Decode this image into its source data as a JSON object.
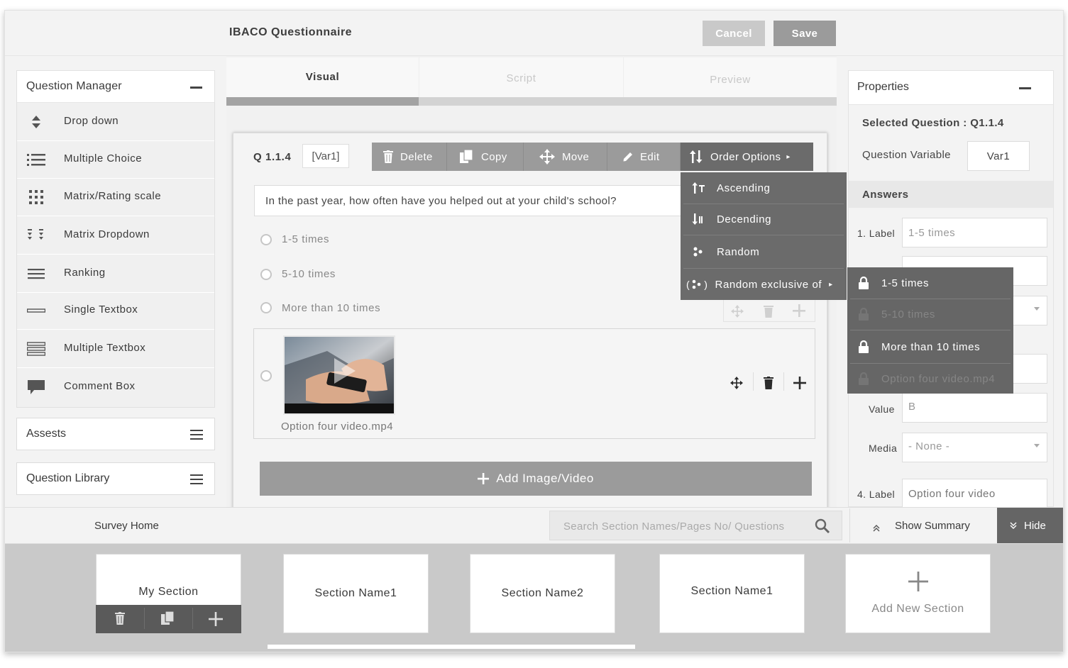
{
  "app": {
    "title": "IBACO Questionnaire",
    "cancel_label": "Cancel",
    "save_label": "Save"
  },
  "question_manager": {
    "title": "Question Manager",
    "items": [
      {
        "label": "Drop down",
        "icon": "updown-icon"
      },
      {
        "label": "Multiple Choice",
        "icon": "list-icon"
      },
      {
        "label": "Matrix/Rating scale",
        "icon": "grid-icon"
      },
      {
        "label": "Matrix Dropdown",
        "icon": "matrix-dropdown-icon"
      },
      {
        "label": "Ranking",
        "icon": "ranking-icon"
      },
      {
        "label": "Single Textbox",
        "icon": "single-textbox-icon"
      },
      {
        "label": "Multiple Textbox",
        "icon": "multiple-textbox-icon"
      },
      {
        "label": "Comment Box",
        "icon": "comment-icon"
      }
    ]
  },
  "assets_panel": {
    "title": "Assests"
  },
  "library_panel": {
    "title": "Question Library"
  },
  "tabs": [
    "Visual",
    "Script",
    "Preview"
  ],
  "question": {
    "number": "Q 1.1.4",
    "variable": "[Var1]",
    "text": "In the past year, how often have you helped out at your child's school?",
    "options": [
      "1-5 times",
      "5-10 times",
      "More than 10 times"
    ],
    "media_label": "Option four video.mp4",
    "add_media_label": "Add Image/Video"
  },
  "toolbar": {
    "delete": "Delete",
    "copy": "Copy",
    "move": "Move",
    "edit": "Edit",
    "order_options": "Order Options"
  },
  "order_menu": {
    "ascending": "Ascending",
    "descending": "Decending",
    "random": "Random",
    "random_exclusive": "Random exclusive of"
  },
  "exclusive_submenu": [
    {
      "label": "1-5 times",
      "locked": true
    },
    {
      "label": "5-10 times",
      "locked": false
    },
    {
      "label": "More than 10 times",
      "locked": true
    },
    {
      "label": "Option four video.mp4",
      "locked": false
    }
  ],
  "properties": {
    "title": "Properties",
    "selected_question": "Selected Question : Q1.1.4",
    "variable_label": "Question Variable",
    "variable_value": "Var1",
    "answers_label": "Answers",
    "label1": "1. Label",
    "label1_value": "1-5 times",
    "value_label": "Value",
    "value_value": "B",
    "media_label": "Media",
    "media_value": "- None -",
    "label4": "4. Label",
    "label4_placeholder": "Option four video"
  },
  "bottom_bar": {
    "survey_home": "Survey Home",
    "search_placeholder": "Search  Section Names/Pages No/ Questions",
    "show_summary": "Show Summary",
    "hide": "Hide"
  },
  "sections": [
    "My Section",
    "Section Name1",
    "Section Name2",
    "Section Name1"
  ],
  "add_section_label": "Add New Section"
}
